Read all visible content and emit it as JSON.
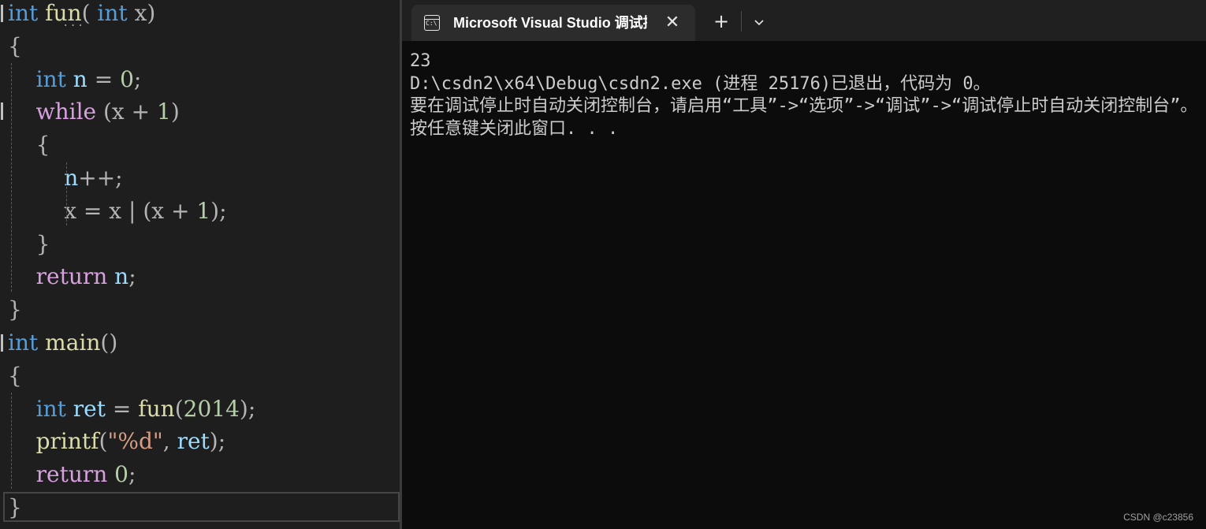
{
  "editor": {
    "lines": [
      {
        "i": "",
        "t": [
          [
            "kw-int",
            "int"
          ],
          [
            "",
            ""
          ],
          [
            "fn",
            " fun"
          ],
          [
            "punct",
            "("
          ],
          [
            "kw-int",
            " int"
          ],
          [
            "op",
            " x"
          ],
          [
            "punct",
            ")"
          ]
        ]
      },
      {
        "i": "",
        "t": [
          [
            "punct",
            "{"
          ]
        ]
      },
      {
        "i": "    ",
        "t": [
          [
            "kw-int",
            "int"
          ],
          [
            "var",
            " n"
          ],
          [
            "op",
            " ="
          ],
          [
            "num",
            " 0"
          ],
          [
            "punct",
            ";"
          ]
        ]
      },
      {
        "i": "    ",
        "t": [
          [
            "kw-ctl",
            "while"
          ],
          [
            "op",
            " (x"
          ],
          [
            "op",
            " +"
          ],
          [
            "num",
            " 1"
          ],
          [
            "punct",
            ")"
          ]
        ]
      },
      {
        "i": "    ",
        "t": [
          [
            "punct",
            "{"
          ]
        ]
      },
      {
        "i": "        ",
        "t": [
          [
            "var",
            "n"
          ],
          [
            "op",
            "++"
          ],
          [
            "punct",
            ";"
          ]
        ]
      },
      {
        "i": "        ",
        "t": [
          [
            "op",
            "x"
          ],
          [
            "op",
            " ="
          ],
          [
            "op",
            " x"
          ],
          [
            "op",
            " |"
          ],
          [
            "op",
            " (x"
          ],
          [
            "op",
            " +"
          ],
          [
            "num",
            " 1"
          ],
          [
            "punct",
            ");"
          ]
        ]
      },
      {
        "i": "    ",
        "t": [
          [
            "punct",
            "}"
          ]
        ]
      },
      {
        "i": "    ",
        "t": [
          [
            "kw-ctl",
            "return"
          ],
          [
            "var",
            " n"
          ],
          [
            "punct",
            ";"
          ]
        ]
      },
      {
        "i": "",
        "t": [
          [
            "punct",
            "}"
          ]
        ]
      },
      {
        "i": "",
        "t": [
          [
            "kw-int",
            "int"
          ],
          [
            "fn",
            " main"
          ],
          [
            "punct",
            "()"
          ]
        ]
      },
      {
        "i": "",
        "t": [
          [
            "punct",
            "{"
          ]
        ]
      },
      {
        "i": "    ",
        "t": [
          [
            "kw-int",
            "int"
          ],
          [
            "var",
            " ret"
          ],
          [
            "op",
            " ="
          ],
          [
            "fn",
            " fun"
          ],
          [
            "punct",
            "("
          ],
          [
            "num",
            "2014"
          ],
          [
            "punct",
            ");"
          ]
        ]
      },
      {
        "i": "    ",
        "t": [
          [
            "fn",
            "printf"
          ],
          [
            "punct",
            "("
          ],
          [
            "str",
            "\"%d\""
          ],
          [
            "punct",
            ","
          ],
          [
            "var",
            " ret"
          ],
          [
            "punct",
            ");"
          ]
        ]
      },
      {
        "i": "    ",
        "t": [
          [
            "kw-ctl",
            "return"
          ],
          [
            "num",
            " 0"
          ],
          [
            "punct",
            ";"
          ]
        ]
      },
      {
        "i": "",
        "t": [
          [
            "punct",
            "}"
          ]
        ]
      }
    ]
  },
  "terminal": {
    "tab_title": "Microsoft Visual Studio 调试控制台",
    "tab_icon_glyph": "C:\\",
    "close_glyph": "✕",
    "new_tab_glyph": "+",
    "output": [
      "23",
      "D:\\csdn2\\x64\\Debug\\csdn2.exe (进程 25176)已退出，代码为 0。",
      "要在调试停止时自动关闭控制台，请启用“工具”->“选项”->“调试”->“调试停止时自动关闭控制台”。",
      "按任意键关闭此窗口. . ."
    ]
  },
  "watermark": "CSDN @c23856",
  "colors": {
    "editor_bg": "#1e1e1e",
    "terminal_bg": "#0c0c0c",
    "keyword_blue": "#569cd6",
    "keyword_purple": "#d8a0df",
    "function_yellow": "#dcdcaa",
    "variable_cyan": "#9cdcfe",
    "number_green": "#b5cea8",
    "string_orange": "#d69d85"
  }
}
